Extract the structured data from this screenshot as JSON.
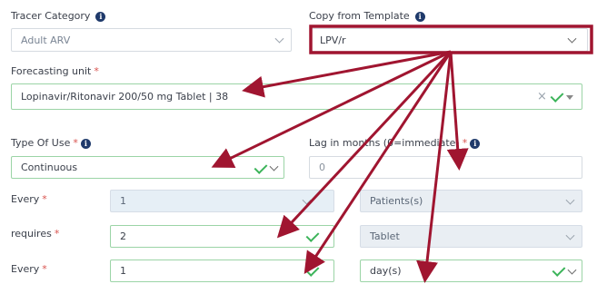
{
  "labels": {
    "tracer_category": "Tracer Category",
    "copy_from_template": "Copy from Template",
    "forecasting_unit": "Forecasting unit",
    "type_of_use": "Type Of Use",
    "lag_in_months": "Lag in months (0=immediate)",
    "every_1": "Every",
    "requires": "requires",
    "every_2": "Every",
    "required_marker": "*",
    "info_glyph": "i"
  },
  "fields": {
    "tracer_category": "Adult ARV",
    "copy_from_template": "LPV/r",
    "forecasting_unit": "Lopinavir/Ritonavir 200/50 mg Tablet | 38",
    "type_of_use": "Continuous",
    "lag_placeholder": "0",
    "every_1_value": "1",
    "every_1_unit": "Patients(s)",
    "requires_value": "2",
    "requires_unit": "Tablet",
    "every_2_value": "1",
    "every_2_unit": "day(s)"
  },
  "icons": {
    "clear": "×"
  },
  "colors": {
    "annotation": "#a01530",
    "success": "#3cb45a",
    "info": "#1f3a6b"
  }
}
